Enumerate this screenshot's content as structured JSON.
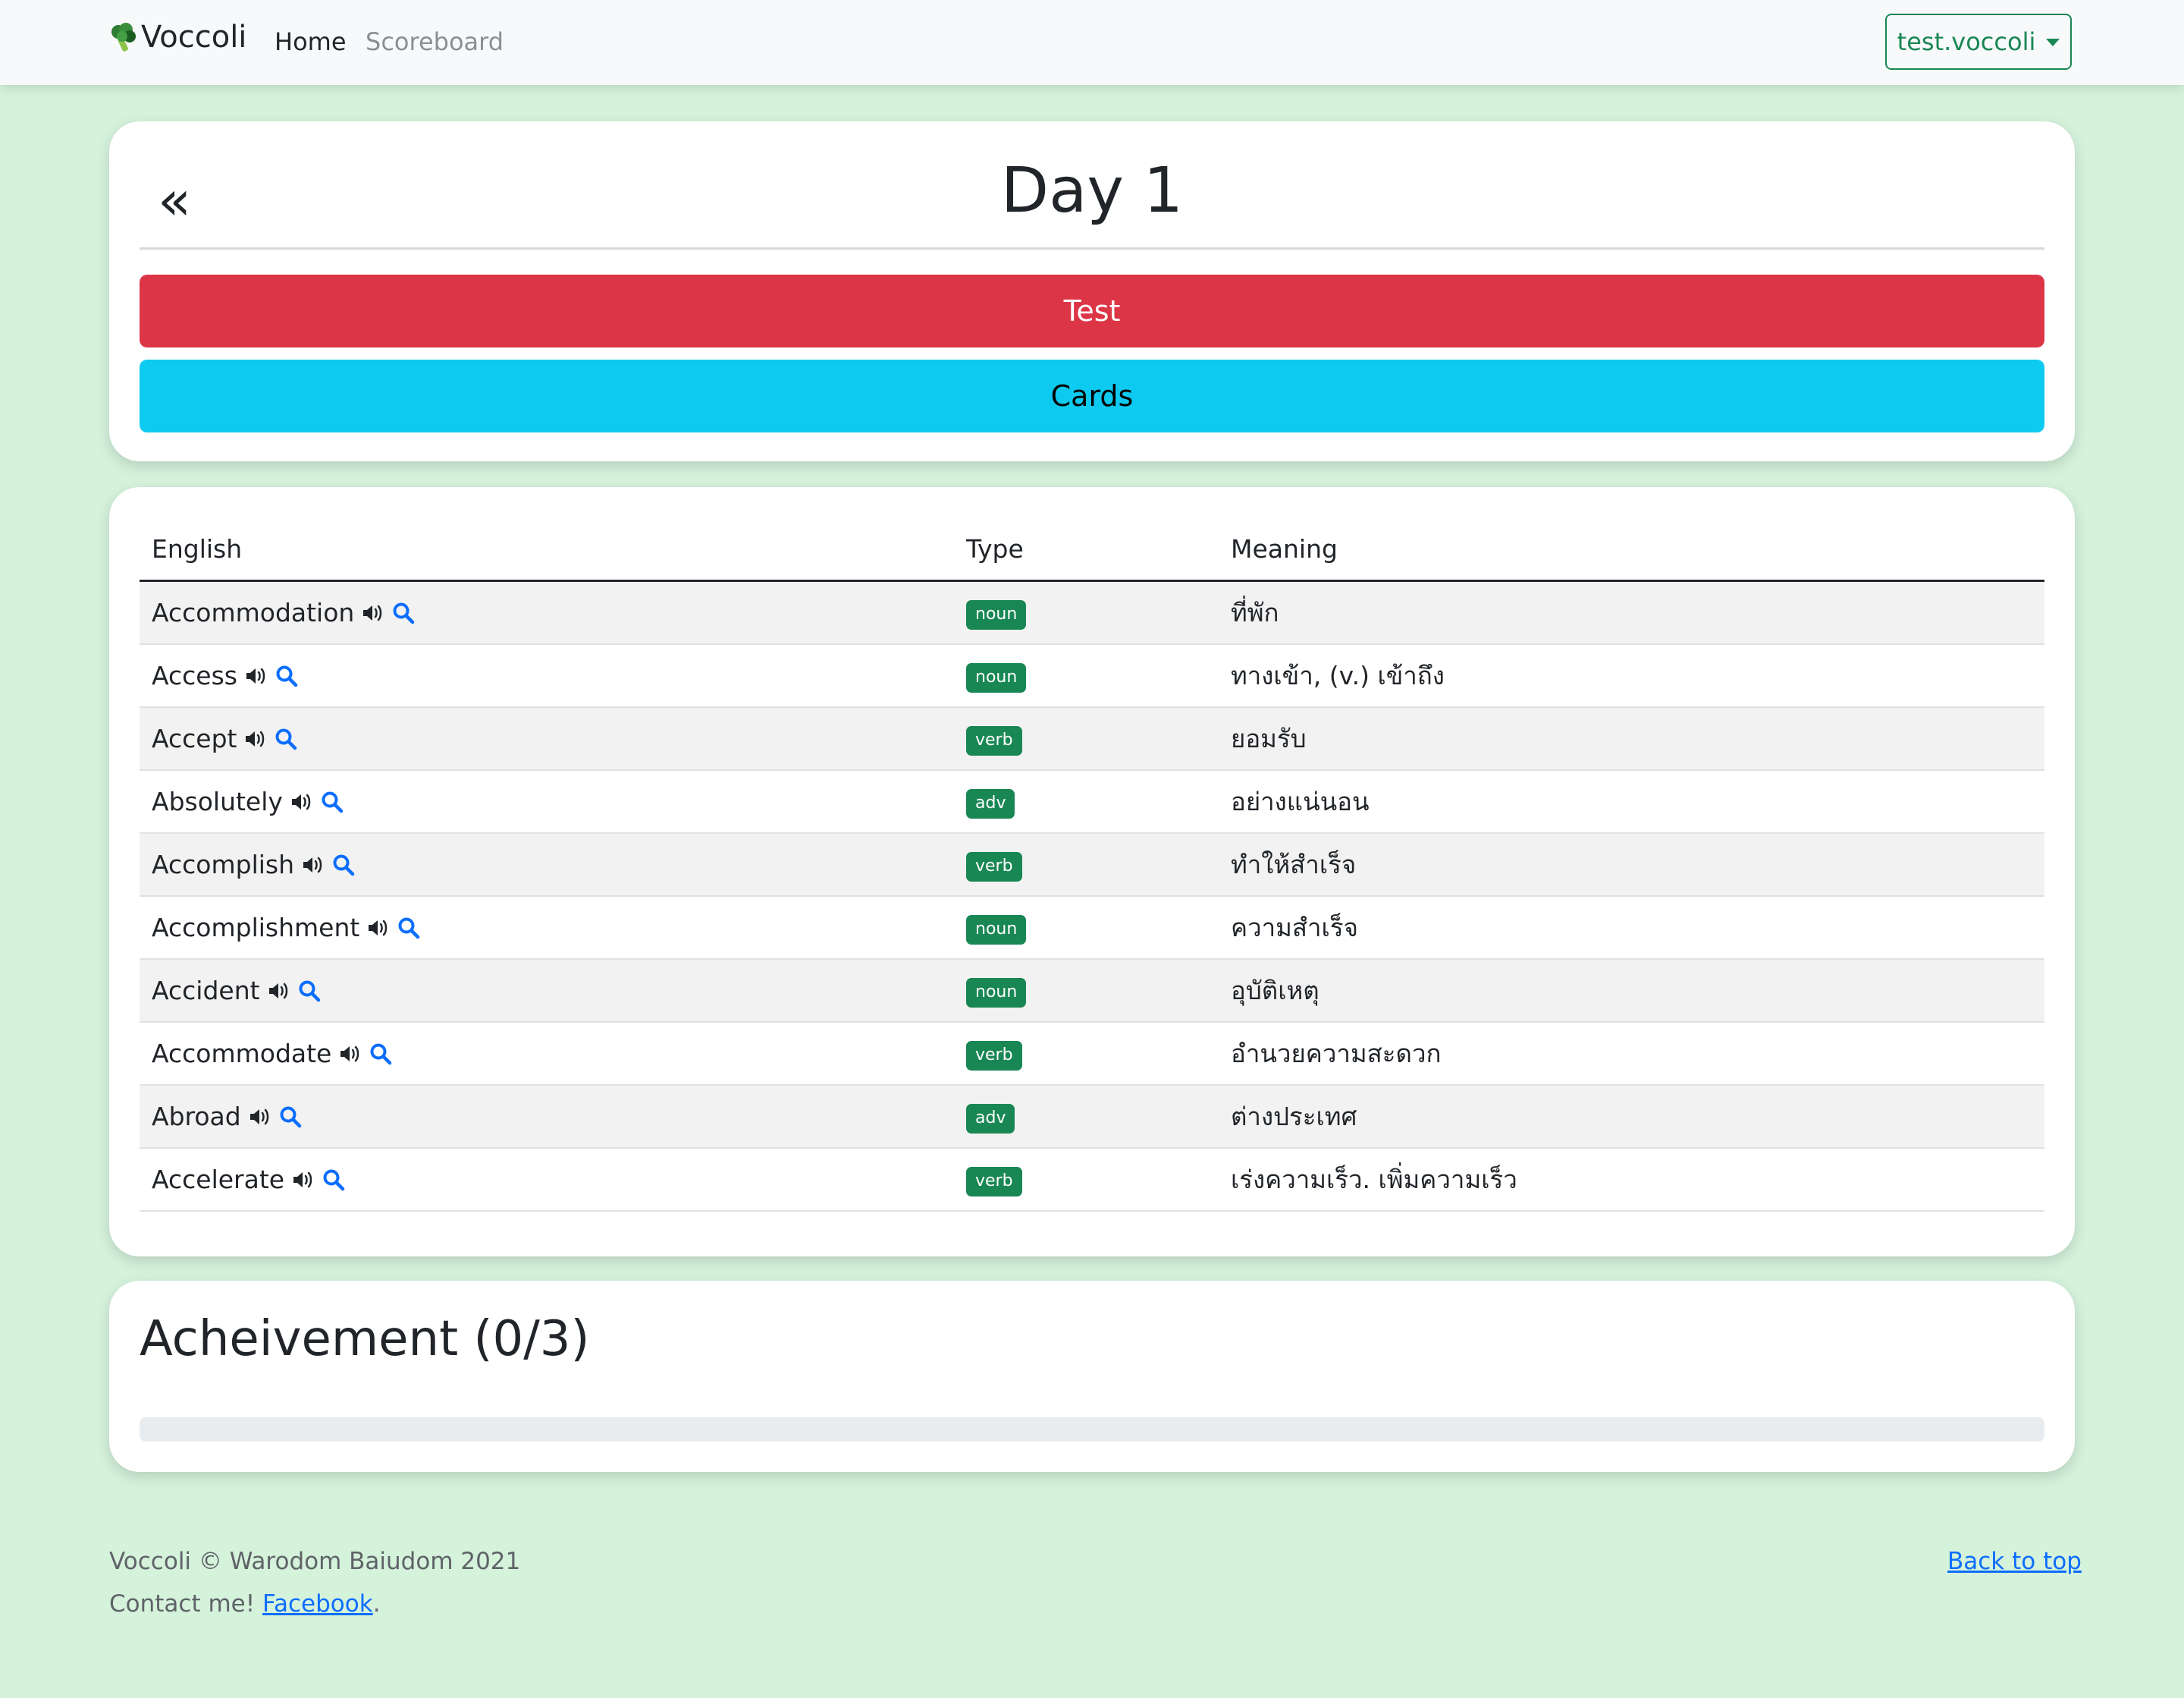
{
  "nav": {
    "brand": "Voccoli",
    "home": "Home",
    "scoreboard": "Scoreboard",
    "user": "test.voccoli"
  },
  "header": {
    "back_symbol": "«",
    "title": "Day 1",
    "test_label": "Test",
    "cards_label": "Cards"
  },
  "table": {
    "headers": [
      "English",
      "Type",
      "Meaning"
    ],
    "rows": [
      {
        "word": "Accommodation",
        "type": "noun",
        "meaning": "ที่พัก"
      },
      {
        "word": "Access",
        "type": "noun",
        "meaning": "ทางเข้า, (v.) เข้าถึง"
      },
      {
        "word": "Accept",
        "type": "verb",
        "meaning": "ยอมรับ"
      },
      {
        "word": "Absolutely",
        "type": "adv",
        "meaning": "อย่างแน่นอน"
      },
      {
        "word": "Accomplish",
        "type": "verb",
        "meaning": "ทำให้สำเร็จ"
      },
      {
        "word": "Accomplishment",
        "type": "noun",
        "meaning": "ความสำเร็จ"
      },
      {
        "word": "Accident",
        "type": "noun",
        "meaning": "อุบัติเหตุ"
      },
      {
        "word": "Accommodate",
        "type": "verb",
        "meaning": "อำนวยความสะดวก"
      },
      {
        "word": "Abroad",
        "type": "adv",
        "meaning": "ต่างประเทศ"
      },
      {
        "word": "Accelerate",
        "type": "verb",
        "meaning": "เร่งความเร็ว. เพิ่มความเร็ว"
      }
    ]
  },
  "achievement": {
    "title": "Acheivement (0/3)",
    "progress_fraction": 0
  },
  "footer": {
    "copyright": "Voccoli © Warodom Baiudom 2021",
    "contact_prefix": "Contact me! ",
    "facebook": "Facebook",
    "contact_suffix": ".",
    "back_to_top": "Back to top"
  },
  "colors": {
    "page_bg": "#d5f2db",
    "danger": "#dc3545",
    "info": "#0dcaf0",
    "success": "#198754",
    "primary": "#0d6efd"
  },
  "icons": {
    "brand": "broccoli-icon",
    "audio": "speaker-icon",
    "lookup": "search-icon",
    "dropdown": "caret-down-icon"
  }
}
